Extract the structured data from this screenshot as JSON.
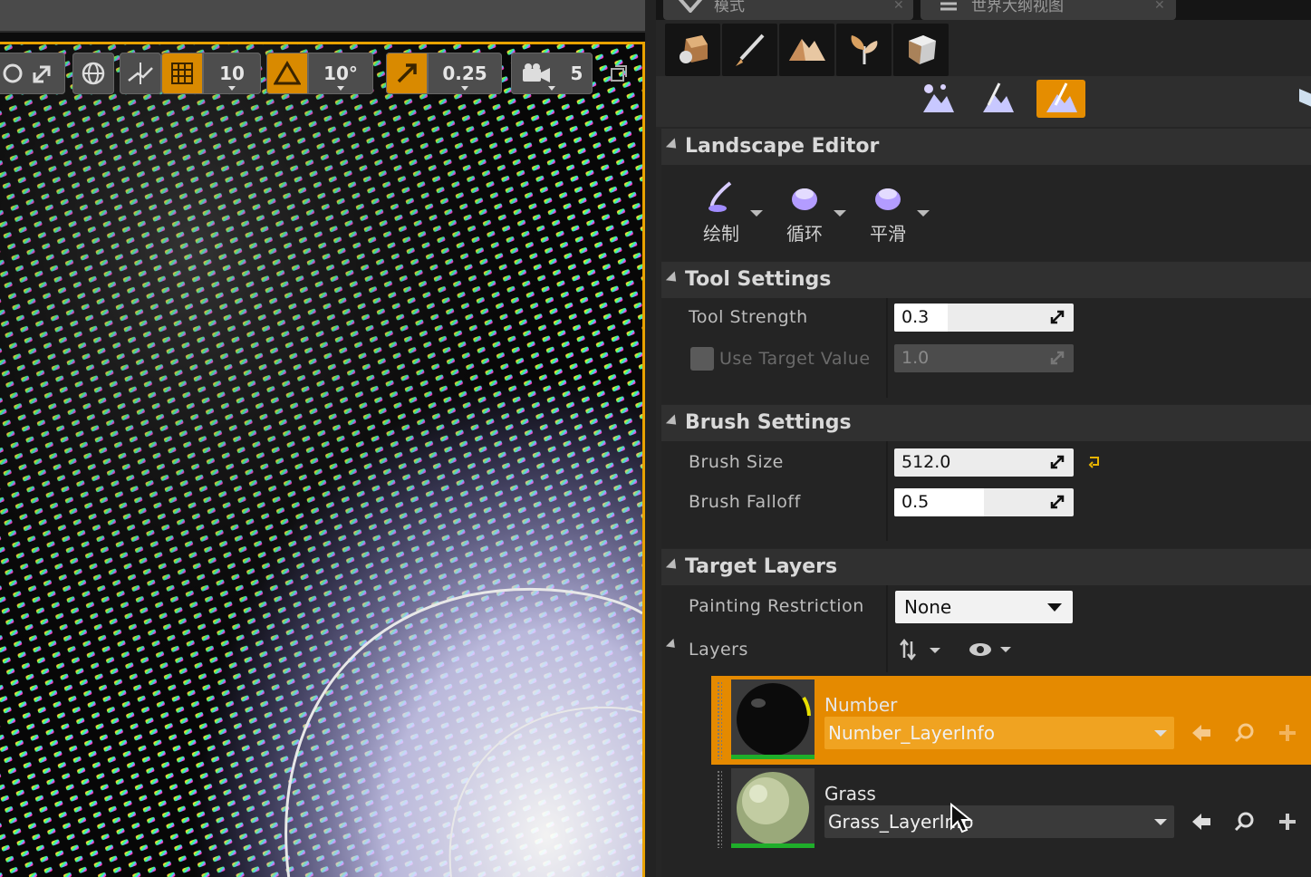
{
  "tabs": [
    {
      "label": "模式"
    },
    {
      "label": "世界大纲视图"
    }
  ],
  "viewport_toolbar": {
    "grid_snap": "10",
    "rotation_snap": "10°",
    "scale_snap": "0.25",
    "camera_speed": "5"
  },
  "mode_icons": [
    "place-mode-icon",
    "paint-mode-icon",
    "landscape-mode-icon",
    "foliage-mode-icon",
    "geometry-mode-icon"
  ],
  "subtool_icons": [
    "manage-icon",
    "sculpt-icon",
    "paint-icon"
  ],
  "landscape_editor": {
    "title": "Landscape Editor",
    "tools": [
      {
        "label": "绘制"
      },
      {
        "label": "循环"
      },
      {
        "label": "平滑"
      }
    ]
  },
  "tool_settings": {
    "title": "Tool Settings",
    "tool_strength_label": "Tool Strength",
    "tool_strength_value": "0.3",
    "tool_strength_fraction": 0.3,
    "use_target_label": "Use Target Value",
    "use_target_value": "1.0"
  },
  "brush_settings": {
    "title": "Brush Settings",
    "brush_size_label": "Brush Size",
    "brush_size_value": "512.0",
    "brush_falloff_label": "Brush Falloff",
    "brush_falloff_value": "0.5",
    "brush_falloff_fraction": 0.5
  },
  "target_layers": {
    "title": "Target Layers",
    "painting_restriction_label": "Painting Restriction",
    "painting_restriction_value": "None",
    "layers_label": "Layers",
    "layers": [
      {
        "name": "Number",
        "info": "Number_LayerInfo",
        "selected": true
      },
      {
        "name": "Grass",
        "info": "Grass_LayerInfo",
        "selected": false
      }
    ]
  },
  "colors": {
    "accent": "#e58d00",
    "selection_border": "#e8a200",
    "panel_bg": "#262626"
  }
}
